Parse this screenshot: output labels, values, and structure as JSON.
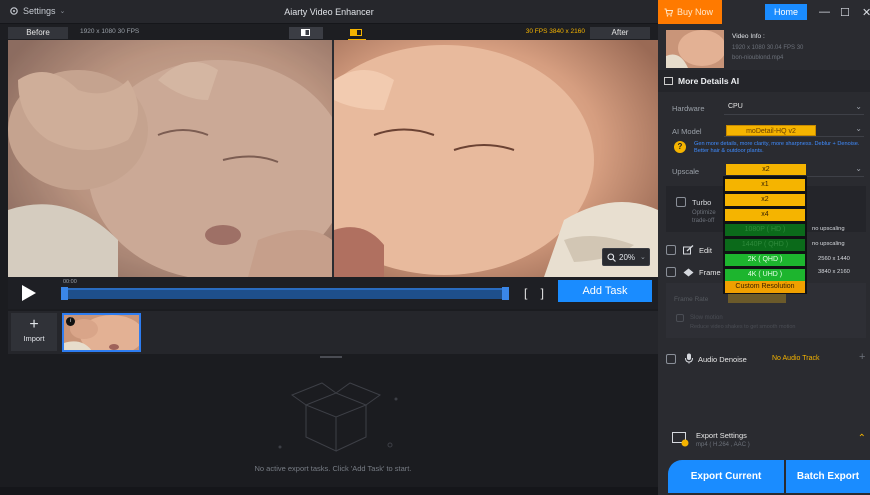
{
  "app": {
    "title": "Aiarty Video Enhancer",
    "settings_label": "Settings"
  },
  "compare": {
    "before_label": "Before",
    "before_info": "1920 x 1080  30 FPS",
    "after_label": "After",
    "after_info": "30 FPS  3840 x 2160"
  },
  "preview": {
    "zoom_label": "20%"
  },
  "timeline": {
    "timestamp": "00:00",
    "add_task_label": "Add Task",
    "brackets": "[ ]"
  },
  "strip": {
    "import_plus": "+",
    "import_label": "Import",
    "clip_badge": "i"
  },
  "export_area": {
    "empty_message": "No active export tasks. Click 'Add Task' to start."
  },
  "topright": {
    "buy_label": "Buy Now",
    "home_label": "Home",
    "minimize": "—",
    "maximize": "☐",
    "close": "✕"
  },
  "video_info": {
    "title": "Video Info :",
    "line1": "1920 x 1080  30.04  FPS  30",
    "line2": "bon-nioublond.mp4"
  },
  "details": {
    "section_label": "More Details AI",
    "hardware_label": "Hardware",
    "hardware_value": "CPU",
    "model_label": "AI Model",
    "model_value": "moDetail-HQ  v2",
    "model_desc": "Gen more details, more clarity, more sharpness. Deblur + Denoise. Better hair & outdoor plants.",
    "upscale_label": "Upscale",
    "upscale_value": "x2",
    "turbo_label": "Turbo",
    "turbo_desc1": "Optimize",
    "turbo_desc2": "trade-off",
    "edit_label": "Edit",
    "frame_label": "Frame I",
    "frame_row_label": "Frame Rate",
    "frame_sub1": "Slow motion",
    "frame_sub2": "Reduce video shakes to get smooth motion",
    "audio_label": "Audio Denoise",
    "audio_value": "No Audio Track",
    "audio_plus": "+"
  },
  "upscale_dropdown": {
    "items": [
      "x1",
      "x2",
      "x4",
      "1080P ( HD )",
      "1440P ( QHD )",
      "2K ( QHD )",
      "4K ( UHD )",
      "Custom Resolution"
    ],
    "side_1080": "no upscaling",
    "side_1440": "no upscaling",
    "side_2k": "2560 x 1440",
    "side_4k": "3840 x 2160"
  },
  "export": {
    "settings_label": "Export Settings",
    "settings_sub": "mp4 ( H.264 , AAC )",
    "export_current_label": "Export Current",
    "batch_export_label": "Batch Export"
  },
  "colors": {
    "accent": "#1a8cff",
    "warning": "#f5b400",
    "buy": "#ff7a00",
    "success": "#1db52e"
  }
}
